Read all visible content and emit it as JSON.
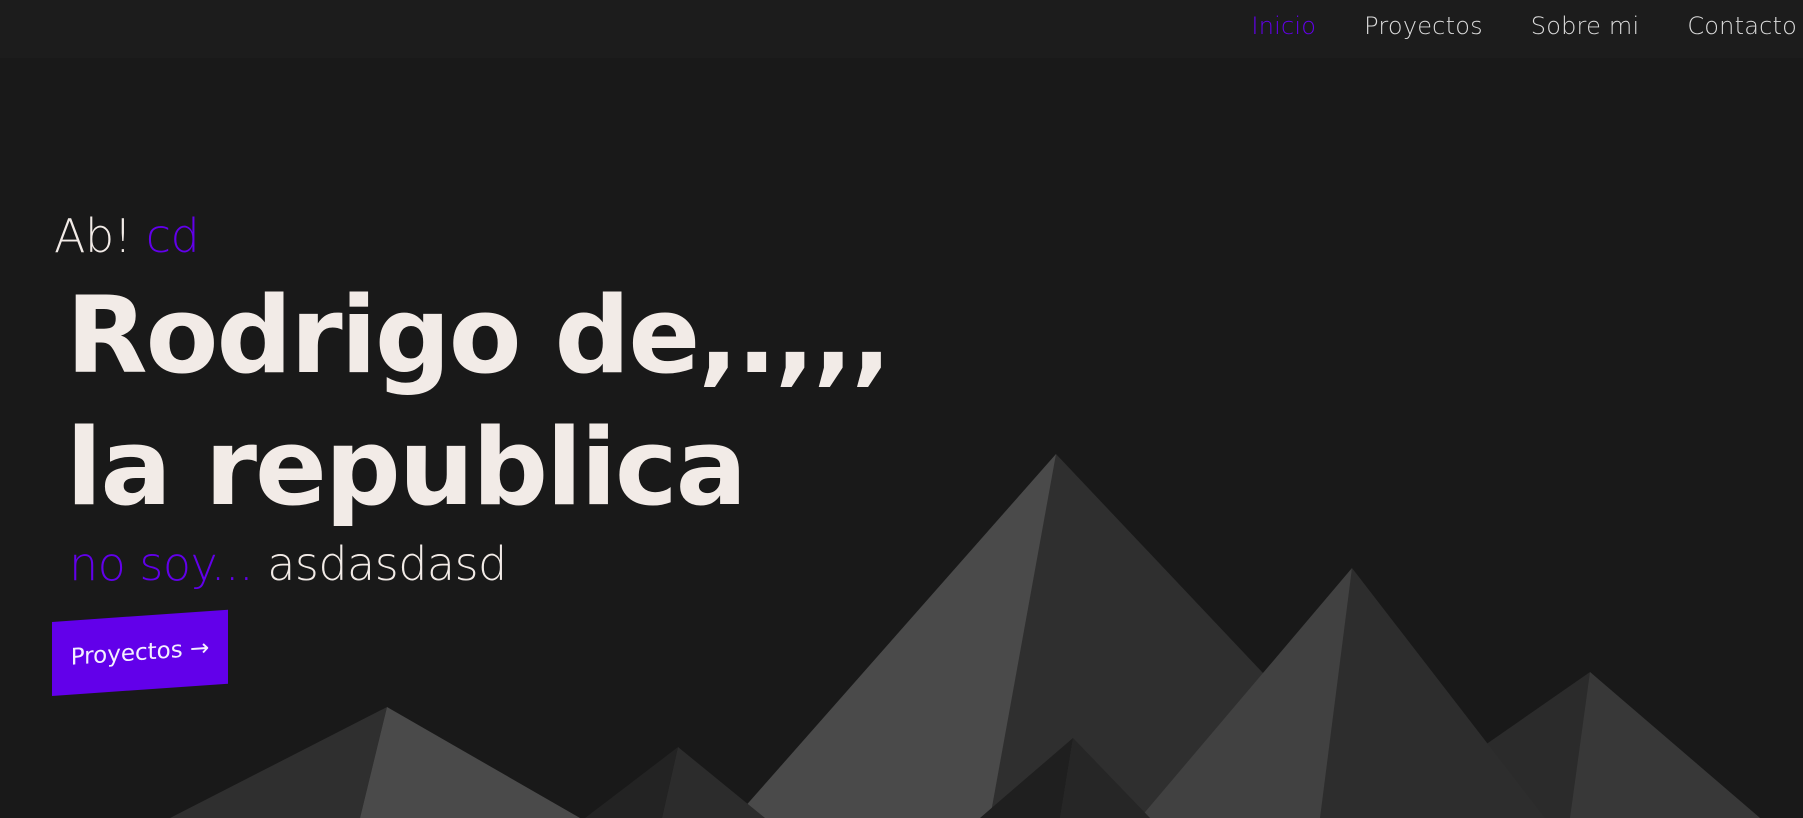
{
  "nav": {
    "items": [
      {
        "label": "Inicio",
        "active": true
      },
      {
        "label": "Proyectos",
        "active": false
      },
      {
        "label": "Sobre mi",
        "active": false
      },
      {
        "label": "Contacto",
        "active": false
      }
    ]
  },
  "hero": {
    "greeting_prefix": "Ab!",
    "greeting_accent": "cd",
    "name_line1": "Rodrigo de,.,,,",
    "name_line2": "la republica",
    "tagline_accent": "no soy...",
    "tagline_rest": "asdasdasd",
    "cta_label": "Proyectos →"
  },
  "colors": {
    "background": "#191919",
    "accent": "#6200ea",
    "text": "#f2ebe7"
  }
}
